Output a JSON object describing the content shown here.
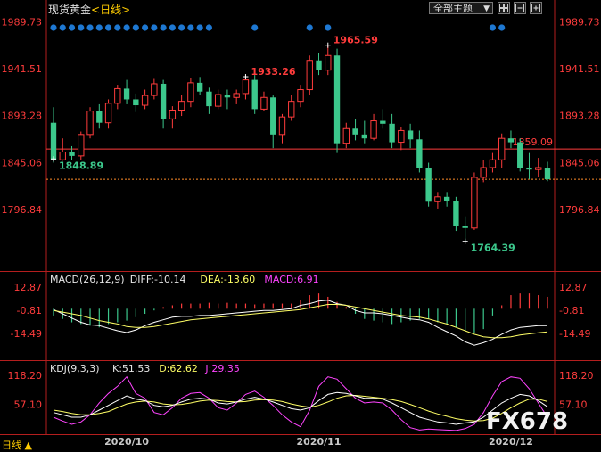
{
  "header": {
    "instrument": "现货黄金",
    "period": "<日线>",
    "theme_label": "全部主题",
    "bottom_label": "日线 ▲"
  },
  "watermark": "FX678",
  "colors": {
    "up": "#ff3c3c",
    "down": "#3cc88c",
    "bg": "#000000",
    "axis_red": "#ff3c3c",
    "dot_blue": "#1e78d2",
    "diff_line": "#ffffff",
    "dea_line": "#ffff66",
    "kdj_k": "#ffffff",
    "kdj_d": "#ffff66",
    "kdj_j": "#ff44ff"
  },
  "chart_data": [
    {
      "type": "candlestick",
      "title": "现货黄金<日线>",
      "ylim": [
        1765,
        1990
      ],
      "y_ticks": [
        1989.73,
        1941.51,
        1893.28,
        1845.06,
        1796.84
      ],
      "x_tick_labels": [
        {
          "label": "2020/10",
          "index": 8
        },
        {
          "label": "2020/11",
          "index": 29
        },
        {
          "label": "2020/12",
          "index": 50
        }
      ],
      "candles": [
        [
          1886,
          1902,
          1845,
          1848
        ],
        [
          1848,
          1870,
          1847,
          1856
        ],
        [
          1856,
          1862,
          1848,
          1852
        ],
        [
          1852,
          1877,
          1848,
          1874
        ],
        [
          1874,
          1902,
          1870,
          1898
        ],
        [
          1898,
          1905,
          1880,
          1886
        ],
        [
          1886,
          1910,
          1880,
          1906
        ],
        [
          1906,
          1925,
          1900,
          1921
        ],
        [
          1921,
          1930,
          1905,
          1910
        ],
        [
          1910,
          1916,
          1897,
          1904
        ],
        [
          1904,
          1920,
          1900,
          1914
        ],
        [
          1914,
          1931,
          1910,
          1926
        ],
        [
          1926,
          1930,
          1880,
          1890
        ],
        [
          1890,
          1903,
          1880,
          1899
        ],
        [
          1899,
          1915,
          1893,
          1908
        ],
        [
          1908,
          1932,
          1902,
          1927
        ],
        [
          1927,
          1933,
          1915,
          1918
        ],
        [
          1918,
          1922,
          1895,
          1903
        ],
        [
          1903,
          1920,
          1900,
          1915
        ],
        [
          1915,
          1920,
          1900,
          1912
        ],
        [
          1912,
          1920,
          1905,
          1916
        ],
        [
          1916,
          1935,
          1910,
          1930
        ],
        [
          1930,
          1935,
          1895,
          1900
        ],
        [
          1900,
          1918,
          1898,
          1912
        ],
        [
          1912,
          1914,
          1860,
          1874
        ],
        [
          1874,
          1895,
          1865,
          1892
        ],
        [
          1892,
          1915,
          1888,
          1908
        ],
        [
          1908,
          1925,
          1902,
          1920
        ],
        [
          1920,
          1955,
          1915,
          1950
        ],
        [
          1950,
          1958,
          1935,
          1940
        ],
        [
          1940,
          1966,
          1935,
          1955
        ],
        [
          1955,
          1962,
          1855,
          1865
        ],
        [
          1865,
          1886,
          1860,
          1880
        ],
        [
          1880,
          1890,
          1868,
          1874
        ],
        [
          1874,
          1888,
          1865,
          1870
        ],
        [
          1870,
          1895,
          1868,
          1888
        ],
        [
          1888,
          1900,
          1880,
          1885
        ],
        [
          1885,
          1895,
          1860,
          1866
        ],
        [
          1866,
          1882,
          1858,
          1878
        ],
        [
          1878,
          1885,
          1860,
          1869
        ],
        [
          1869,
          1878,
          1835,
          1840
        ],
        [
          1840,
          1845,
          1800,
          1805
        ],
        [
          1805,
          1815,
          1798,
          1810
        ],
        [
          1810,
          1815,
          1800,
          1806
        ],
        [
          1806,
          1810,
          1775,
          1780
        ],
        [
          1780,
          1790,
          1764,
          1778
        ],
        [
          1778,
          1835,
          1776,
          1830
        ],
        [
          1830,
          1848,
          1825,
          1840
        ],
        [
          1840,
          1855,
          1835,
          1848
        ],
        [
          1848,
          1875,
          1840,
          1870
        ],
        [
          1870,
          1878,
          1860,
          1866
        ],
        [
          1866,
          1870,
          1836,
          1840
        ],
        [
          1840,
          1855,
          1828,
          1838
        ],
        [
          1838,
          1850,
          1830,
          1840
        ],
        [
          1840,
          1846,
          1826,
          1828
        ]
      ],
      "annotations": [
        {
          "text": "1933.26",
          "index": 21,
          "value": 1933.26,
          "kind": "high"
        },
        {
          "text": "1965.59",
          "index": 30,
          "value": 1965.59,
          "kind": "high"
        },
        {
          "text": "1848.89",
          "index": 0,
          "value": 1848.89,
          "kind": "low"
        },
        {
          "text": "1764.39",
          "index": 45,
          "value": 1764.39,
          "kind": "low"
        }
      ],
      "price_lines": [
        {
          "label": "1859.09",
          "value": 1859.09,
          "color": "#ff3c3c",
          "style": "solid"
        },
        {
          "value": 1828,
          "color": "#ff8c28",
          "style": "dashed"
        }
      ],
      "signal_dots": [
        0,
        1,
        2,
        3,
        4,
        5,
        6,
        7,
        8,
        9,
        10,
        11,
        12,
        13,
        14,
        15,
        16,
        17,
        22,
        28,
        30,
        48,
        49
      ]
    },
    {
      "type": "macd",
      "title": "MACD(26,12,9)",
      "legend": [
        {
          "name": "DIFF",
          "value": "-10.14",
          "color": "#e6e6e6"
        },
        {
          "name": "DEA",
          "value": "-13.60",
          "color": "#ffff66"
        },
        {
          "name": "MACD",
          "value": "6.91",
          "color": "#ff44ff"
        }
      ],
      "ylim": [
        -24,
        18
      ],
      "y_ticks": [
        12.87,
        -0.81,
        -14.49
      ],
      "diff": [
        -0.5,
        -3,
        -5.5,
        -8,
        -9.5,
        -10,
        -11.5,
        -13,
        -14,
        -12.5,
        -10,
        -8,
        -6.5,
        -5,
        -4.5,
        -4.5,
        -4,
        -4,
        -3.5,
        -3,
        -2.5,
        -2,
        -1.5,
        -1,
        -1,
        -0.5,
        0,
        2,
        3,
        4.5,
        5,
        3,
        2,
        -1,
        -2.5,
        -2.5,
        -3,
        -4,
        -5,
        -6,
        -6.5,
        -8,
        -11,
        -13.5,
        -16,
        -19.5,
        -21.5,
        -20,
        -18,
        -15,
        -12.5,
        -11,
        -10.5,
        -10,
        -10
      ],
      "dea": [
        -1,
        -2,
        -3,
        -4,
        -5.5,
        -7,
        -8,
        -9,
        -10.5,
        -11,
        -11,
        -10.5,
        -9.5,
        -8.5,
        -7.5,
        -6.5,
        -6,
        -5.5,
        -5,
        -4.5,
        -4,
        -3.5,
        -3,
        -2.5,
        -2,
        -1.5,
        -1,
        -0.5,
        0.5,
        1.5,
        2.5,
        2.5,
        2,
        1,
        0,
        -1,
        -2,
        -3,
        -4,
        -4.5,
        -5,
        -6,
        -7.5,
        -9,
        -11,
        -13,
        -15,
        -16.5,
        -17,
        -17,
        -16.5,
        -15.5,
        -14.8,
        -14.2,
        -13.6
      ],
      "hist": [
        -4,
        -6,
        -8,
        -9,
        -10,
        -11,
        -9,
        -8,
        -7,
        -5,
        -3,
        -1,
        1,
        2,
        3,
        3,
        3,
        3.5,
        3,
        3.5,
        3,
        3,
        2.5,
        3,
        3,
        3,
        3,
        5,
        8,
        9,
        7,
        4,
        1,
        -3,
        -6,
        -7,
        -8,
        -9,
        -8,
        -7,
        -6,
        -6,
        -8,
        -9,
        -11,
        -13,
        -14,
        -12,
        -4,
        2,
        8,
        9,
        9,
        8,
        7
      ]
    },
    {
      "type": "kdj",
      "title": "KDJ(9,3,3)",
      "legend": [
        {
          "name": "K",
          "value": "51.53",
          "color": "#e6e6e6"
        },
        {
          "name": "D",
          "value": "62.62",
          "color": "#ffff66"
        },
        {
          "name": "J",
          "value": "29.35",
          "color": "#ff44ff"
        }
      ],
      "ylim": [
        0,
        135
      ],
      "y_ticks": [
        118.2,
        57.1
      ],
      "k": [
        40,
        35,
        30,
        30,
        35,
        45,
        55,
        65,
        75,
        68,
        65,
        55,
        52,
        55,
        62,
        68,
        70,
        68,
        60,
        58,
        62,
        68,
        72,
        68,
        62,
        55,
        48,
        45,
        50,
        65,
        78,
        82,
        80,
        75,
        70,
        70,
        68,
        60,
        50,
        40,
        30,
        25,
        20,
        18,
        15,
        18,
        20,
        30,
        45,
        60,
        70,
        78,
        75,
        65,
        52
      ],
      "d": [
        45,
        42,
        38,
        35,
        35,
        38,
        42,
        50,
        58,
        62,
        64,
        62,
        58,
        56,
        57,
        60,
        64,
        66,
        65,
        63,
        62,
        63,
        66,
        67,
        66,
        63,
        58,
        54,
        51,
        55,
        62,
        70,
        75,
        76,
        74,
        72,
        70,
        67,
        63,
        57,
        50,
        43,
        37,
        32,
        27,
        24,
        22,
        23,
        28,
        38,
        50,
        60,
        68,
        68,
        63
      ],
      "j": [
        30,
        22,
        15,
        20,
        35,
        60,
        80,
        95,
        115,
        80,
        70,
        40,
        35,
        50,
        70,
        80,
        82,
        70,
        50,
        45,
        60,
        78,
        85,
        72,
        55,
        35,
        20,
        10,
        45,
        95,
        115,
        110,
        90,
        70,
        60,
        62,
        60,
        45,
        25,
        8,
        3,
        5,
        4,
        3,
        2,
        6,
        15,
        40,
        75,
        105,
        115,
        112,
        90,
        60,
        30
      ]
    }
  ]
}
